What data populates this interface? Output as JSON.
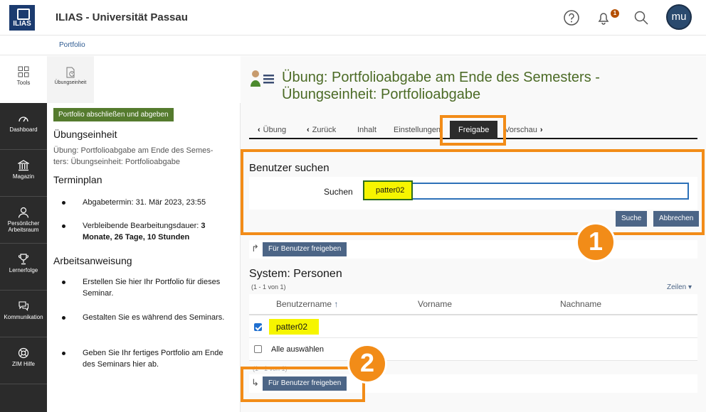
{
  "header": {
    "logo": "ILIAS",
    "site_title": "ILIAS - Universität Passau",
    "notification_count": "1",
    "avatar_initials": "mu"
  },
  "breadcrumb": "Portfolio",
  "mainbar": [
    {
      "label": "Tools",
      "icon": "grid-icon"
    },
    {
      "label": "Dashboard",
      "icon": "dashboard-icon"
    },
    {
      "label": "Magazin",
      "icon": "library-icon"
    },
    {
      "label": "Persönlicher Arbeitsraum",
      "icon": "person-icon"
    },
    {
      "label": "Lernerfolge",
      "icon": "trophy-icon"
    },
    {
      "label": "Kommunikation",
      "icon": "chat-icon"
    },
    {
      "label": "ZIM Hilfe",
      "icon": "lifebuoy-icon"
    }
  ],
  "slate": {
    "tab_label": "Übungseinheit",
    "submit_button": "Portfolio abschließen und abgeben",
    "heading_unit": "Übungseinheit",
    "unit_description_1": "Übung: Portfolioabgabe am Ende des Semes-",
    "unit_description_2": "ters: Übungseinheit: Portfolioabgabe",
    "heading_schedule": "Terminplan",
    "deadline": "Abgabetermin: 31. Mär 2023, 23:55",
    "remaining_prefix": "Verbleibende Bearbeitungsdauer: ",
    "remaining_value_1": "3",
    "remaining_value_2": "Monate, 26 Tage, 10 Stunden",
    "heading_instructions": "Arbeitsanweisung",
    "instructions": [
      "Erstellen Sie hier Ihr Portfolio für dieses Seminar.",
      "Gestalten Sie es während des Seminars.",
      "Geben Sie Ihr fertiges Portfolio am Ende des Seminars hier ab."
    ]
  },
  "page": {
    "title_line1": "Übung: Portfolioabgabe am Ende des Semesters -",
    "title_line2": "Übungseinheit: Portfolioabgabe",
    "tabs": [
      "Übung",
      "Zurück",
      "Inhalt",
      "Einstellungen",
      "Freigabe",
      "Vorschau"
    ],
    "active_tab": "Freigabe"
  },
  "user_search": {
    "title": "Benutzer suchen",
    "label": "Suchen",
    "value": "patter02",
    "search_button": "Suche",
    "cancel_button": "Abbrechen"
  },
  "share_button": "Für Benutzer freigeben",
  "results": {
    "title": "System: Personen",
    "count": "(1 - 1 von 1)",
    "rows_toggle": "Zeilen",
    "columns": [
      "Benutzername",
      "Vorname",
      "Nachname"
    ],
    "rows": [
      {
        "username": "patter02",
        "checked": true
      }
    ],
    "select_all": "Alle auswählen"
  },
  "markers": [
    "1",
    "2"
  ],
  "colors": {
    "accent_orange": "#f28c18",
    "title_green": "#4c6b26",
    "highlight_yellow": "#f6f500",
    "button_blue": "#4c6586"
  }
}
